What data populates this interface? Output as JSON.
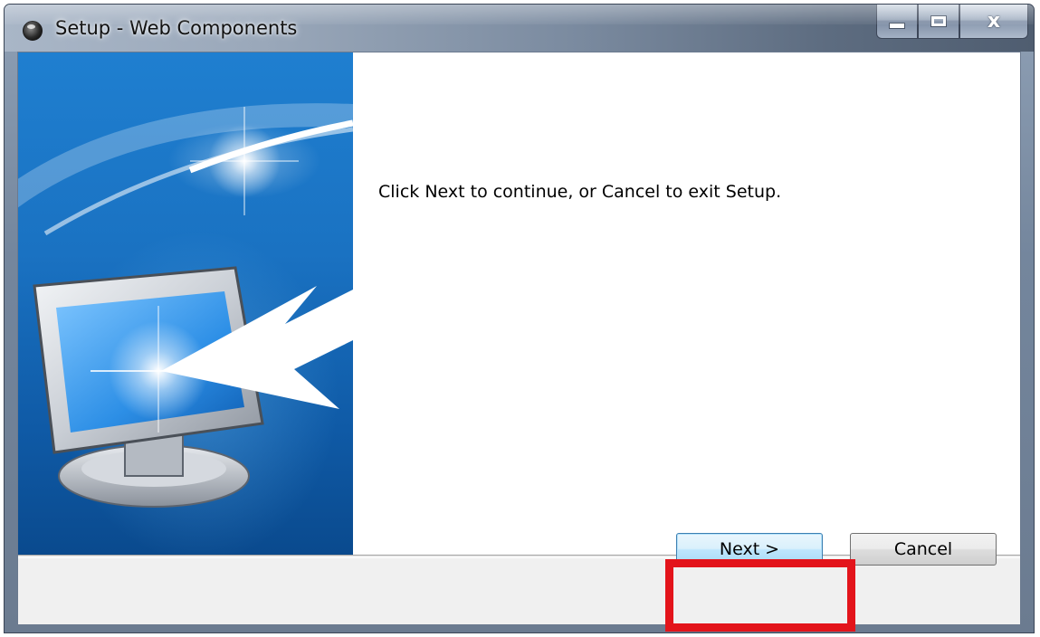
{
  "window": {
    "title": "Setup - Web Components",
    "caption_buttons": {
      "minimize_icon": "minimize-icon",
      "maximize_icon": "maximize-icon",
      "close_glyph": "x"
    }
  },
  "content": {
    "message": "Click Next to continue, or Cancel to exit Setup."
  },
  "buttons": {
    "next_label": "Next >",
    "cancel_label": "Cancel"
  },
  "banner": {
    "illustration": "monitor-with-arrow-icon"
  },
  "colors": {
    "banner_blue": "#1a72c2",
    "highlight_red": "#e3141b",
    "next_button_blue": "#bee6fd"
  }
}
